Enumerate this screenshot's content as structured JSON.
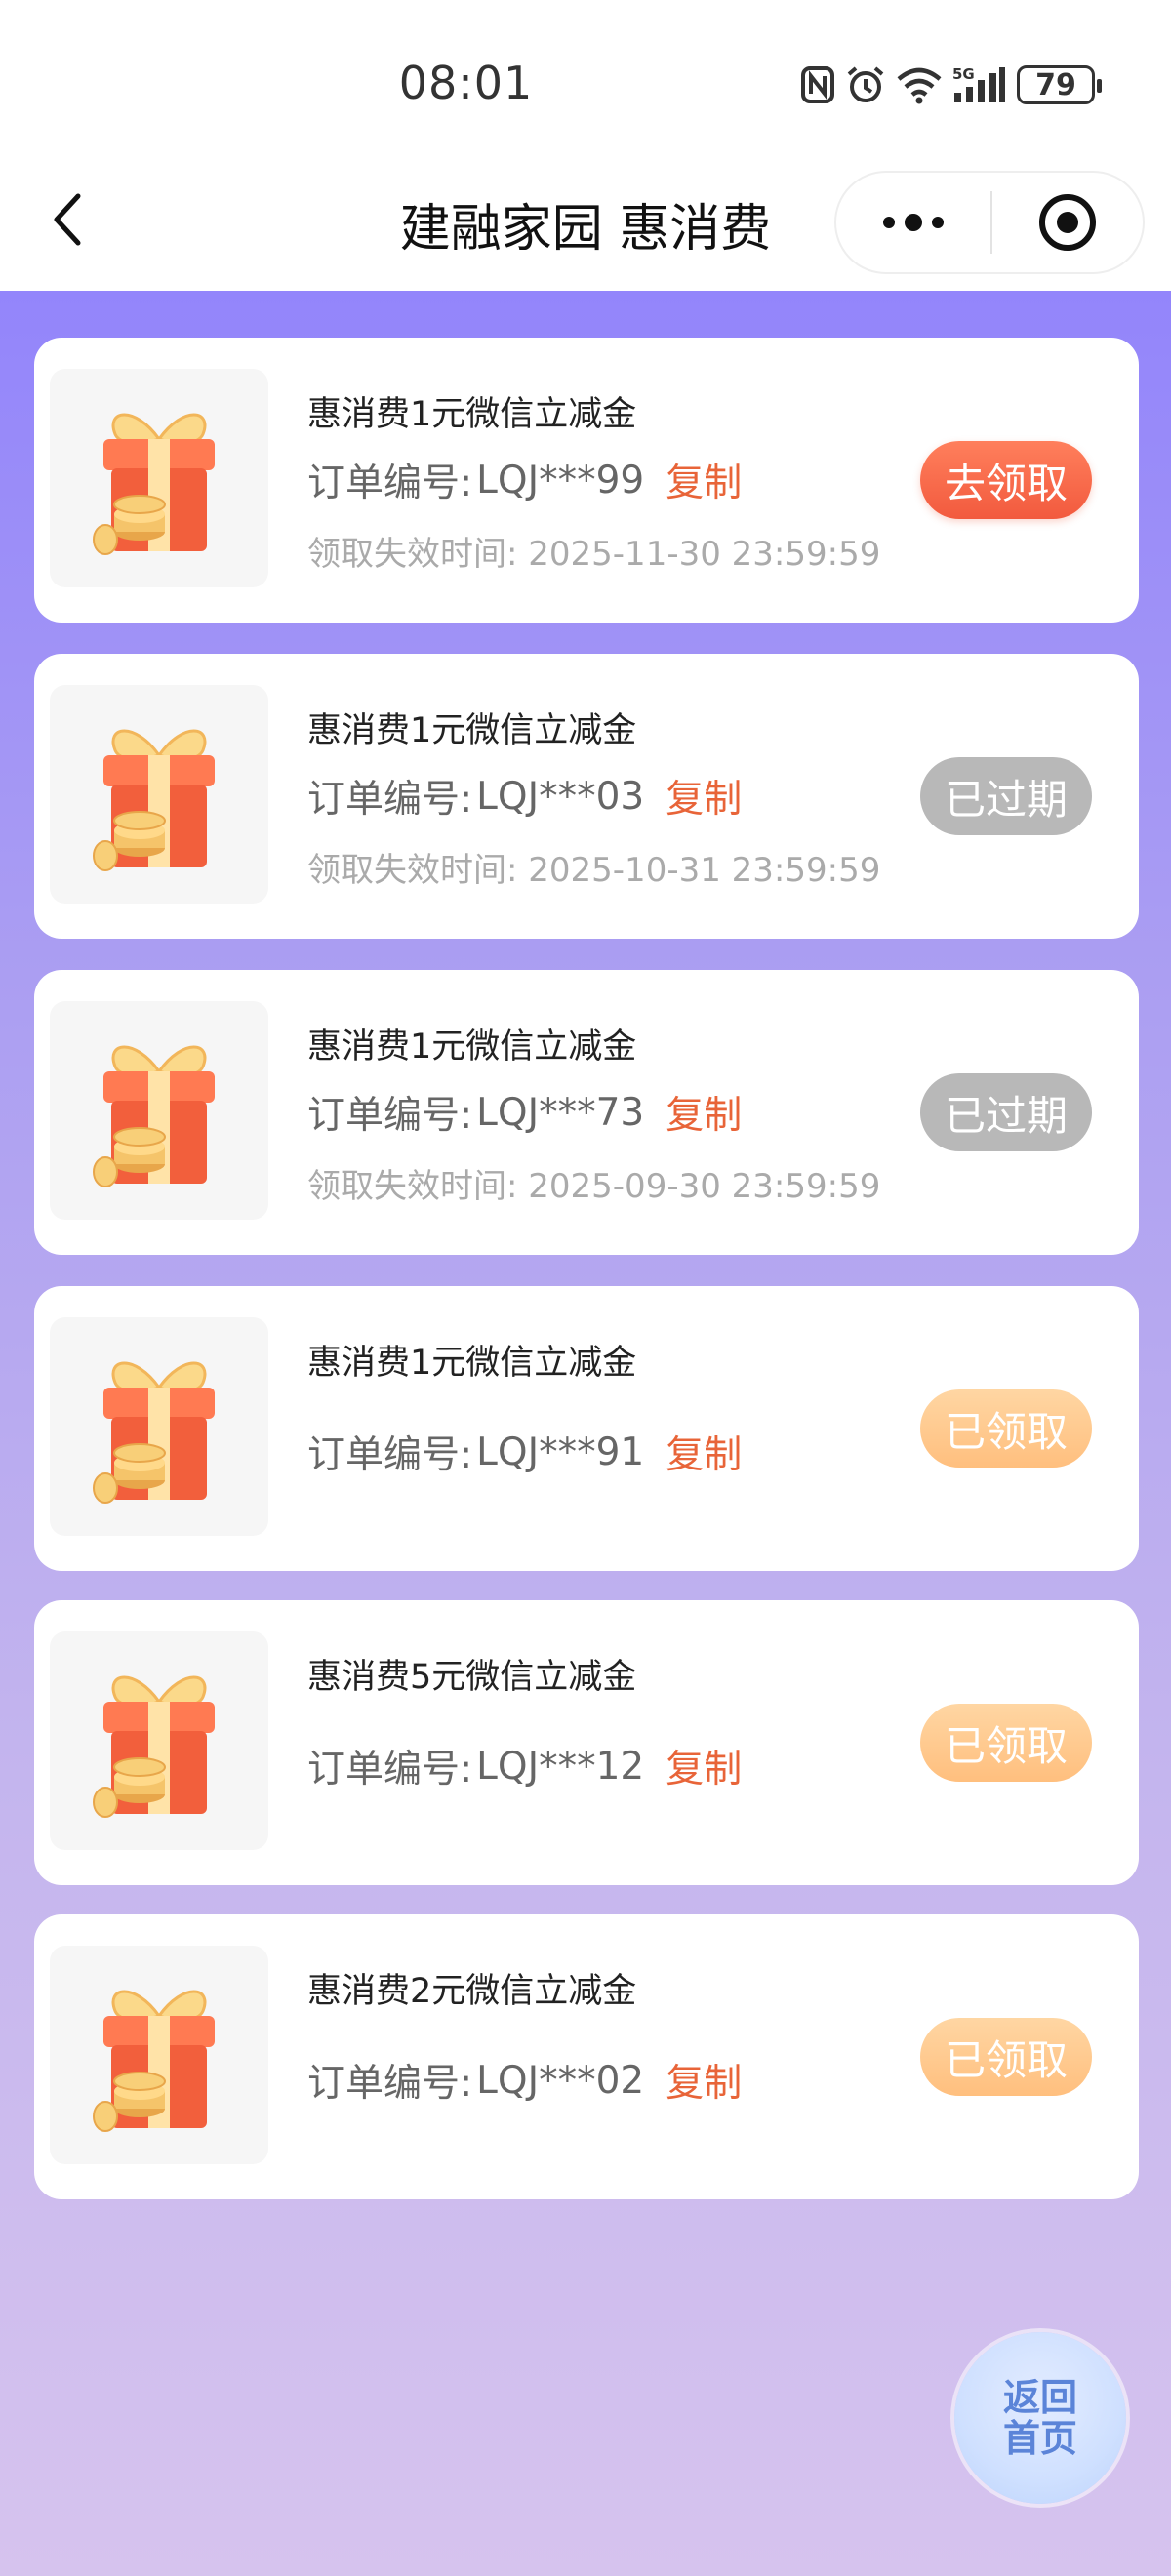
{
  "status_bar": {
    "time": "08:01",
    "battery": "79",
    "network": "5G"
  },
  "navbar": {
    "title": "建融家园 惠消费",
    "back_icon": "chevron-left-icon",
    "more_icon": "more-dots-icon",
    "close_icon": "target-close-icon"
  },
  "coupons": [
    {
      "title": "惠消费1元微信立减金",
      "order_label": "订单编号:",
      "order_no": "LQJ***99",
      "copy_label": "复制",
      "expiry": "领取失效时间: 2025-11-30 23:59:59",
      "action": "去领取",
      "status": "claim"
    },
    {
      "title": "惠消费1元微信立减金",
      "order_label": "订单编号:",
      "order_no": "LQJ***03",
      "copy_label": "复制",
      "expiry": "领取失效时间: 2025-10-31 23:59:59",
      "action": "已过期",
      "status": "expired"
    },
    {
      "title": "惠消费1元微信立减金",
      "order_label": "订单编号:",
      "order_no": "LQJ***73",
      "copy_label": "复制",
      "expiry": "领取失效时间: 2025-09-30 23:59:59",
      "action": "已过期",
      "status": "expired"
    },
    {
      "title": "惠消费1元微信立减金",
      "order_label": "订单编号:",
      "order_no": "LQJ***91",
      "copy_label": "复制",
      "action": "已领取",
      "status": "received"
    },
    {
      "title": "惠消费5元微信立减金",
      "order_label": "订单编号:",
      "order_no": "LQJ***12",
      "copy_label": "复制",
      "action": "已领取",
      "status": "received"
    },
    {
      "title": "惠消费2元微信立减金",
      "order_label": "订单编号:",
      "order_no": "LQJ***02",
      "copy_label": "复制",
      "action": "已领取",
      "status": "received"
    }
  ],
  "home_button": {
    "line1": "返回",
    "line2": "首页"
  },
  "colors": {
    "accent_copy": "#e86438",
    "claim_button": "#f25a3e",
    "expired_button": "#b8b8b8",
    "received_button": "#ffbf7e",
    "background_top": "#9385fb",
    "background_bottom": "#d6c3ee"
  }
}
